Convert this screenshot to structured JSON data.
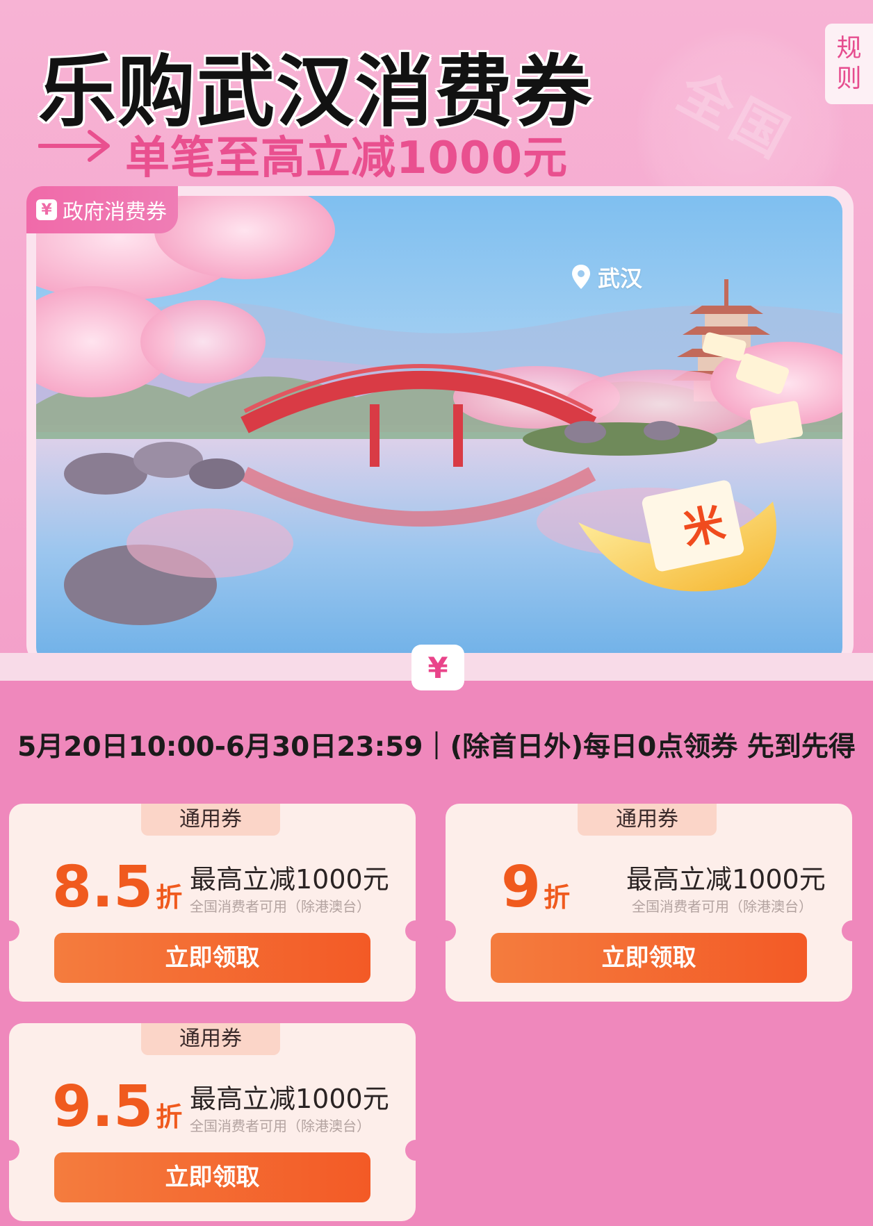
{
  "header": {
    "title": "乐购武汉消费券",
    "subtitle": "单笔至高立减1000元",
    "watermark_text": "全国",
    "rules_button": [
      "规",
      "则"
    ]
  },
  "scene": {
    "tag_icon": "¥",
    "tag_label": "政府消费券",
    "location_label": "武汉",
    "center_tab": "¥"
  },
  "info": {
    "date_line": "5月20日10:00-6月30日23:59｜(除首日外)每日0点领券 先到先得"
  },
  "coupons": [
    {
      "tag": "通用券",
      "discount_num": "8.5",
      "discount_unit": "折",
      "limit": "最高立减1000元",
      "scope": "全国消费者可用（除港澳台）",
      "button": "立即领取"
    },
    {
      "tag": "通用券",
      "discount_num": "9",
      "discount_unit": "折",
      "limit": "最高立减1000元",
      "scope": "全国消费者可用（除港澳台）",
      "button": "立即领取"
    },
    {
      "tag": "通用券",
      "discount_num": "9.5",
      "discount_unit": "折",
      "limit": "最高立减1000元",
      "scope": "全国消费者可用（除港澳台）",
      "button": "立即领取"
    }
  ],
  "colors": {
    "page_bg": "#ef88bc",
    "title_text": "#121212",
    "subtitle_accent": "#e9508f",
    "discount_orange": "#f05a1e",
    "button_orange": "#f35a26"
  },
  "icons": [
    "arrow-right-icon",
    "yen-icon",
    "location-pin-icon",
    "cherry-blossom-scene-illustration",
    "coupon-tickets-illustration"
  ]
}
